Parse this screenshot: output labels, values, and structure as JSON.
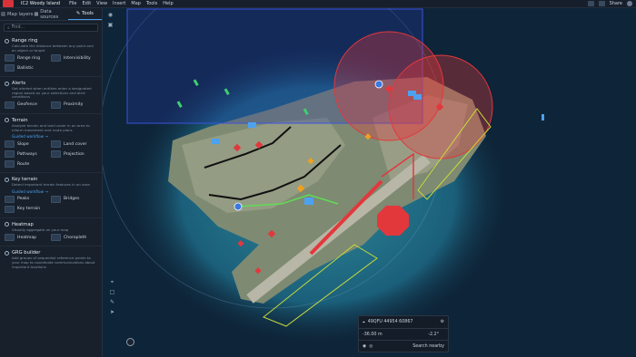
{
  "topbar": {
    "file_menu": [
      "File",
      "Edit",
      "View",
      "Insert",
      "Map",
      "Tools",
      "Help"
    ],
    "doc_title": "IC2 Woody Island",
    "share": "Share"
  },
  "tabs": [
    "Map layers",
    "Data sources",
    "Tools"
  ],
  "search": {
    "placeholder": "Find..."
  },
  "sections": [
    {
      "title": "Range ring",
      "desc": "Calculate the distance between any point and an object or target",
      "link": "",
      "tools": [
        "Range ring",
        "Intervisibility",
        "Ballistic"
      ]
    },
    {
      "title": "Alerts",
      "desc": "Get alerted when entities enter a designated region based on your selections and alert conditions",
      "link": "",
      "tools": [
        "Geofence",
        "Proximity"
      ]
    },
    {
      "title": "Terrain",
      "desc": "Analyze terrain and land cover in an area to inform movement and route plans",
      "link": "Guided workflow →",
      "tools": [
        "Slope",
        "Land cover",
        "Pathways",
        "Projection",
        "Route"
      ]
    },
    {
      "title": "Key terrain",
      "desc": "Detect important terrain features in an area",
      "link": "Guided workflow →",
      "tools": [
        "Peaks",
        "Bridges",
        "Key terrain"
      ]
    },
    {
      "title": "Heatmap",
      "desc": "Visually aggregate on your map",
      "link": "",
      "tools": [
        "Heatmap",
        "Choropleth"
      ]
    },
    {
      "title": "GRG builder",
      "desc": "Add groups of sequential reference points to your map to coordinate communications about important locations",
      "link": "",
      "tools": []
    }
  ],
  "coordinates": {
    "mgrs": "49QFU 44954 60867",
    "elevation": "-36.00 m",
    "bearing": "-2.2°",
    "search_nearby": "Search nearby"
  },
  "colors": {
    "alert_red": "#e2383c",
    "route_black": "#111111",
    "route_green": "#5fdd55",
    "zone_yellow": "#c7d93a",
    "accent_blue": "#4b9fe8"
  },
  "icons": [
    "logo",
    "layers-icon",
    "database-icon",
    "tools-icon",
    "search-icon",
    "pin-icon",
    "alert-icon",
    "gear-icon",
    "user-avatar"
  ]
}
